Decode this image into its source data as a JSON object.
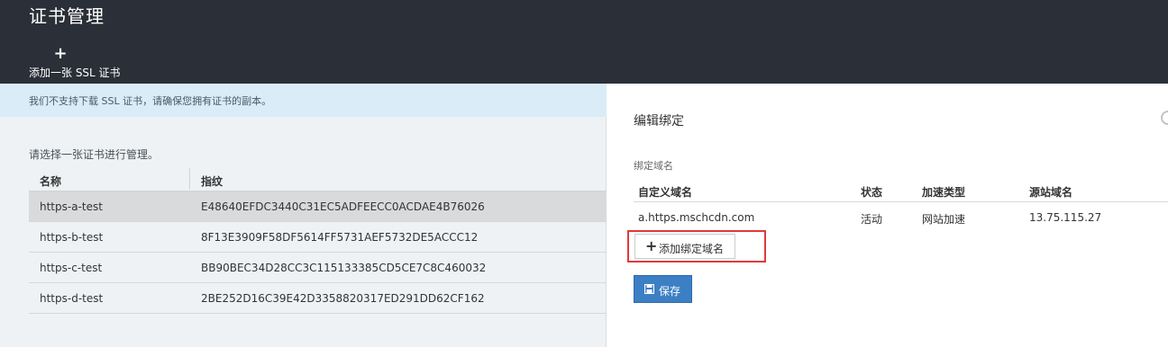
{
  "header": {
    "title": "证书管理",
    "add_cert": {
      "icon": "plus-icon",
      "plus": "+",
      "label": "添加一张 SSL 证书"
    }
  },
  "notice": "我们不支持下载 SSL 证书，请确保您拥有证书的副本。",
  "select_hint": "请选择一张证书进行管理。",
  "cert_table": {
    "headers": [
      "名称",
      "指纹"
    ],
    "rows": [
      {
        "name": "https-a-test",
        "fingerprint": "E48640EFDC3440C31EC5ADFEECC0ACDAE4B76026",
        "selected": true
      },
      {
        "name": "https-b-test",
        "fingerprint": "8F13E3909F58DF5614FF5731AEF5732DE5ACCC12",
        "selected": false
      },
      {
        "name": "https-c-test",
        "fingerprint": "BB90BEC34D28CC3C115133385CD5CE7C8C460032",
        "selected": false
      },
      {
        "name": "https-d-test",
        "fingerprint": "2BE252D16C39E42D3358820317ED291DD62CF162",
        "selected": false
      }
    ]
  },
  "edit_panel": {
    "title": "编辑绑定",
    "bind_label": "绑定域名",
    "columns": [
      "自定义域名",
      "状态",
      "加速类型",
      "源站域名"
    ],
    "rows": [
      {
        "domain": "a.https.mschcdn.com",
        "status": "活动",
        "type": "网站加速",
        "origin": "13.75.115.27"
      }
    ],
    "add_button": {
      "icon": "plus-icon",
      "plus": "+",
      "label": "添加绑定域名"
    },
    "save_button": {
      "icon": "save-icon",
      "label": "保存"
    },
    "colors": {
      "highlight": "#e03a3a",
      "primary": "#3c7fc4",
      "header_bg": "#2b2f38",
      "notice_bg": "#d9ecf7"
    }
  }
}
